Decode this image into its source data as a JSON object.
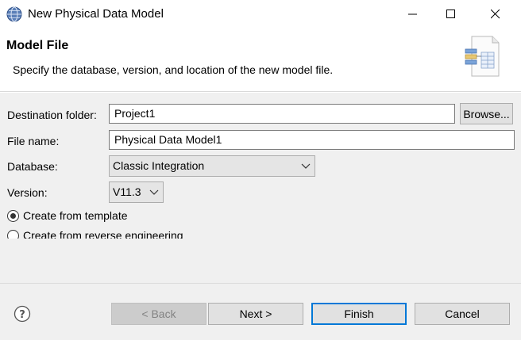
{
  "window": {
    "title": "New Physical Data Model",
    "icon": "globe-app-icon",
    "controls": [
      "minimize-icon",
      "maximize-icon",
      "close-icon"
    ]
  },
  "header": {
    "title": "Model File",
    "description": "Specify the database, version, and location of the new model file.",
    "image": "data-model-file-icon"
  },
  "form": {
    "destination_label": "Destination folder:",
    "destination_value": "Project1",
    "browse_label": "Browse...",
    "filename_label": "File name:",
    "filename_value": "Physical Data Model1",
    "database_label": "Database:",
    "database_value": "Classic Integration",
    "version_label": "Version:",
    "version_value": "V11.3",
    "radio_template_label": "Create from template",
    "radio_template_checked": true,
    "radio_reverse_label": "Create from reverse engineering",
    "radio_reverse_checked": false
  },
  "footer": {
    "help_icon": "help-icon",
    "back_label": "< Back",
    "next_label": "Next >",
    "finish_label": "Finish",
    "cancel_label": "Cancel"
  },
  "colors": {
    "panel": "#f0f0f0",
    "button": "#e1e1e1",
    "disabled_button": "#cccccc",
    "focus_border": "#0078d7"
  }
}
